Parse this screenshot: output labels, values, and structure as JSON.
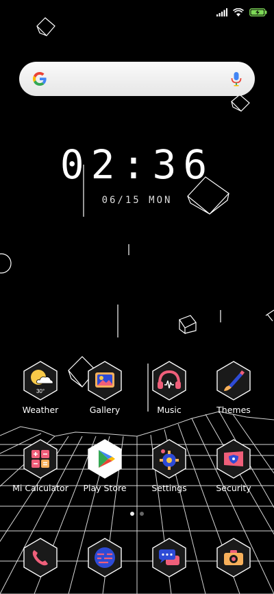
{
  "status_bar": {
    "signal_icon": "signal-icon",
    "wifi_icon": "wifi-icon",
    "battery_icon": "battery-charging-icon",
    "battery_color": "#7ed957"
  },
  "search_bar": {
    "logo_icon": "google-logo-icon",
    "mic_icon": "mic-icon"
  },
  "clock": {
    "time": "02:36",
    "date": "06/15 MON"
  },
  "apps_row1": [
    {
      "label": "Weather",
      "icon": "weather-icon",
      "badge": "30°"
    },
    {
      "label": "Gallery",
      "icon": "gallery-icon"
    },
    {
      "label": "Music",
      "icon": "music-headphones-icon"
    },
    {
      "label": "Themes",
      "icon": "themes-brush-icon"
    }
  ],
  "apps_row2": [
    {
      "label": "Mi Calculator",
      "icon": "calculator-icon"
    },
    {
      "label": "Play Store",
      "icon": "play-store-icon"
    },
    {
      "label": "Settings",
      "icon": "settings-gear-icon"
    },
    {
      "label": "Security",
      "icon": "security-shield-icon"
    }
  ],
  "page_indicator": {
    "pages": 2,
    "active": 1
  },
  "dock": [
    {
      "icon": "phone-icon"
    },
    {
      "icon": "browser-icon"
    },
    {
      "icon": "messages-icon"
    },
    {
      "icon": "camera-icon"
    }
  ],
  "colors": {
    "background": "#000000",
    "accent_pink": "#ef5f7a",
    "accent_blue": "#2e4bd6",
    "accent_yellow": "#f7c948"
  }
}
